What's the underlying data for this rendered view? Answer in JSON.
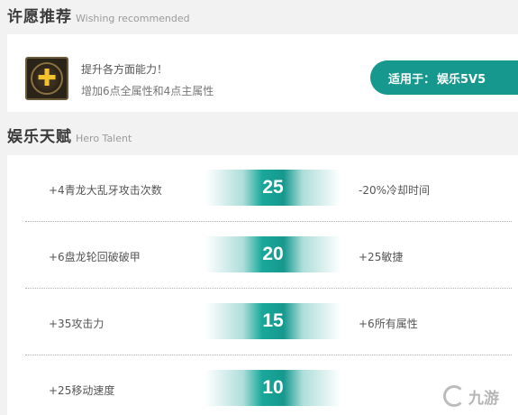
{
  "wish_section": {
    "title": "许愿推荐",
    "subtitle": "Wishing recommended",
    "item": {
      "icon": "golden-plus-icon",
      "line1": "提升各方面能力！",
      "line2": "增加6点全属性和4点主属性"
    },
    "badge": {
      "label": "适用于：",
      "value": "娱乐5V5"
    }
  },
  "talent_section": {
    "title": "娱乐天赋",
    "subtitle": "Hero Talent",
    "rows": [
      {
        "left": "+4青龙大乱牙攻击次数",
        "level": "25",
        "right": "-20%冷却时间"
      },
      {
        "left": "+6盘龙轮回破破甲",
        "level": "20",
        "right": "+25敏捷"
      },
      {
        "left": "+35攻击力",
        "level": "15",
        "right": "+6所有属性"
      },
      {
        "left": "+25移动速度",
        "level": "10",
        "right": ""
      }
    ]
  },
  "watermark": {
    "text": "九游"
  },
  "colors": {
    "accent": "#16988e",
    "background": "#f2f2f2",
    "panel": "#ffffff"
  }
}
